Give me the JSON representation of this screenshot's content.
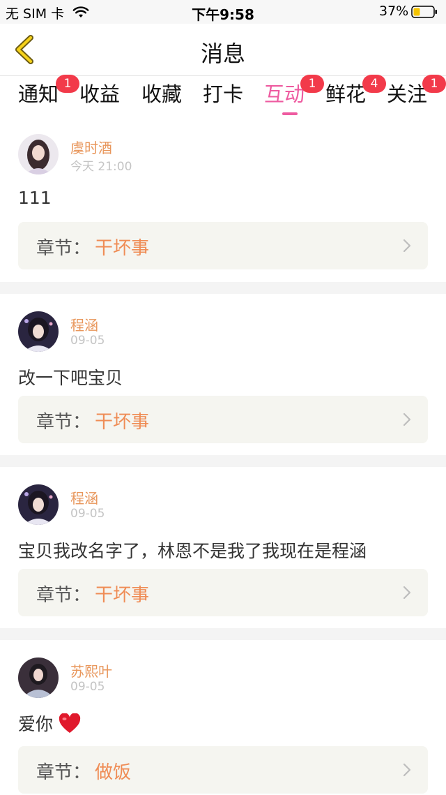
{
  "status_bar": {
    "carrier": "无 SIM 卡",
    "time": "下午9:58",
    "battery": "37%"
  },
  "header": {
    "title": "消息"
  },
  "tabs": [
    {
      "label": "通知",
      "badge": "1"
    },
    {
      "label": "收益",
      "badge": ""
    },
    {
      "label": "收藏",
      "badge": ""
    },
    {
      "label": "打卡",
      "badge": ""
    },
    {
      "label": "互动",
      "badge": "1",
      "active": true
    },
    {
      "label": "鲜花",
      "badge": "4"
    },
    {
      "label": "关注",
      "badge": "1"
    }
  ],
  "chapter_prefix": "章节：",
  "messages": [
    {
      "name": "虞时酒",
      "time": "今天 21:00",
      "text": "111",
      "chapter": "干坏事"
    },
    {
      "name": "程涵",
      "time": "09-05",
      "text": "改一下吧宝贝",
      "chapter": "干坏事"
    },
    {
      "name": "程涵",
      "time": "09-05",
      "text": "宝贝我改名字了，林恩不是我了我现在是程涵",
      "chapter": "干坏事"
    },
    {
      "name": "苏熙叶",
      "time": "09-05",
      "text": "爱你",
      "chapter": "做饭"
    }
  ],
  "colors": {
    "accent": "#ee5ba0",
    "badge": "#f23a4a",
    "name": "#e8965b",
    "chapter": "#ef8c55"
  }
}
